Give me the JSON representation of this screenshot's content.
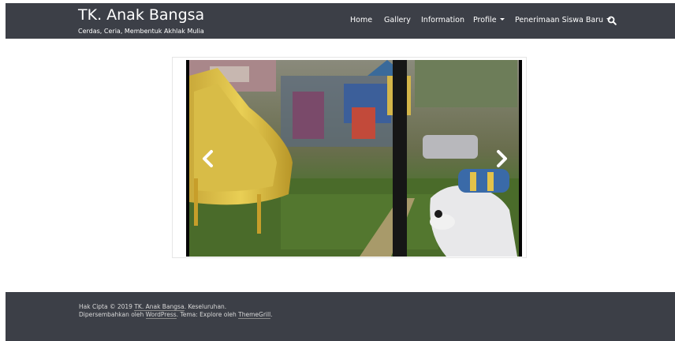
{
  "site": {
    "title": "TK. Anak Bangsa",
    "tagline": "Cerdas, Ceria, Membentuk Akhlak Mulia"
  },
  "nav": {
    "items": [
      {
        "label": "Home",
        "dropdown": false
      },
      {
        "label": "Gallery",
        "dropdown": false
      },
      {
        "label": "Information",
        "dropdown": false
      },
      {
        "label": "Profile",
        "dropdown": true
      },
      {
        "label": "Penerimaan Siswa Baru",
        "dropdown": true
      }
    ],
    "search_icon": "search-icon"
  },
  "slider": {
    "image_subject": "playground with yellow slide and horse ride",
    "prev_icon": "chevron-left-icon",
    "next_icon": "chevron-right-icon"
  },
  "footer": {
    "copyright_prefix": "Hak Cipta © 2019",
    "site_link": "TK. Anak Bangsa",
    "copyright_suffix": ". Keseluruhan.",
    "powered_prefix": "Dipersembahkan oleh",
    "wordpress_link": "WordPress",
    "theme_text": ". Tema: Explore oleh",
    "themegrill_link": "ThemeGrill",
    "end": "."
  },
  "colors": {
    "header_bg": "#3c3f47",
    "footer_bg": "#3c3f47",
    "text_light": "#ffffff"
  }
}
